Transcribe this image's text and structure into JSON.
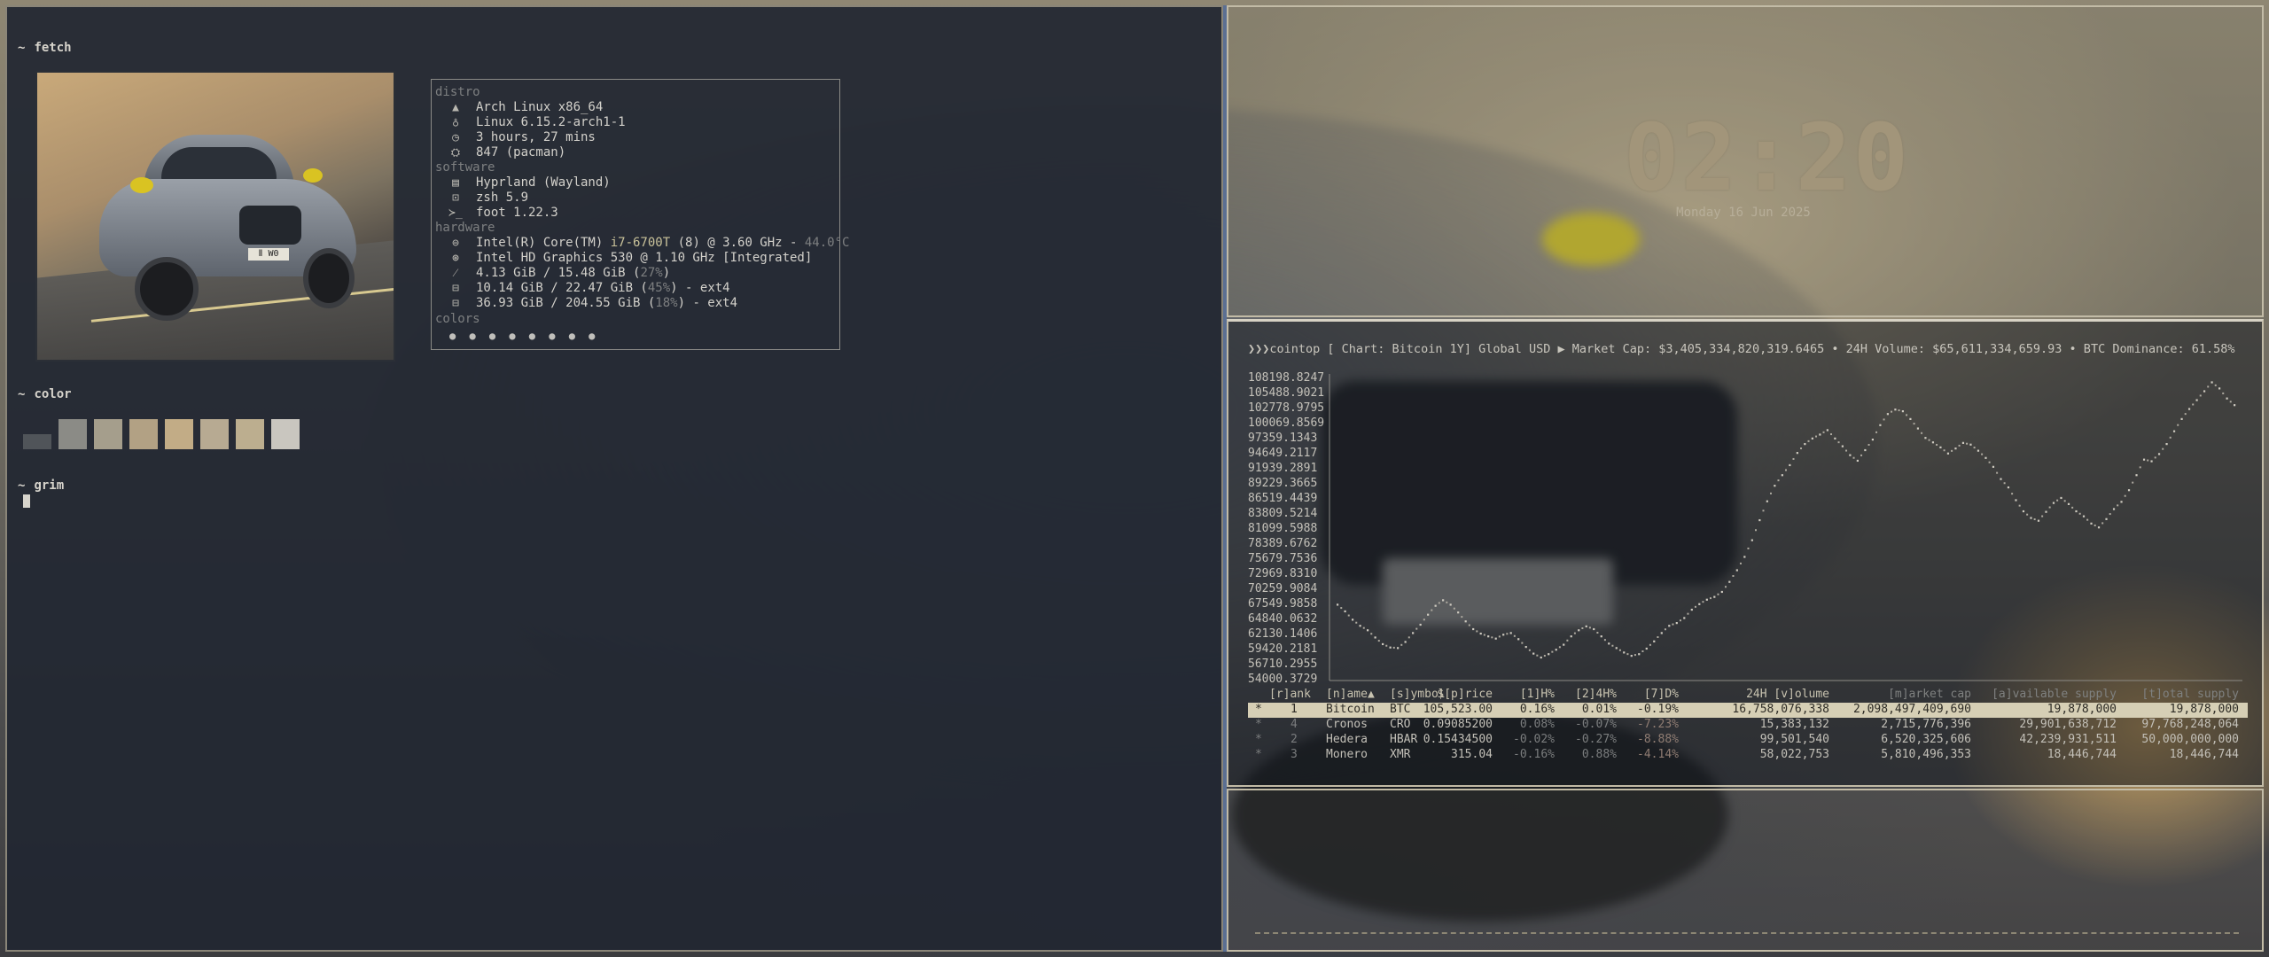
{
  "fetch": {
    "prompt_symbol": "~",
    "prompt_cmd": "fetch",
    "sections": {
      "distro": "distro",
      "software": "software",
      "hardware": "hardware",
      "colors": "colors"
    },
    "distro": [
      {
        "icon": "arch-logo-icon",
        "text": "Arch Linux x86_64"
      },
      {
        "icon": "linux-tux-icon",
        "text": "Linux 6.15.2-arch1-1"
      },
      {
        "icon": "clock-icon",
        "text": "3 hours, 27 mins"
      },
      {
        "icon": "package-icon",
        "text": "847 (pacman)"
      }
    ],
    "software": [
      {
        "icon": "window-icon",
        "text": "Hyprland (Wayland)"
      },
      {
        "icon": "terminal-icon",
        "text": "zsh 5.9"
      },
      {
        "icon": "prompt-icon",
        "text": "foot 1.22.3"
      }
    ],
    "hardware": {
      "cpu_a": "Intel(R) Core(TM) ",
      "cpu_b": "i7-6700T",
      "cpu_c": " (8) @ 3.60 GHz - ",
      "cpu_temp": "44.0°C",
      "gpu": "Intel HD Graphics 530 @ 1.10 GHz [Integrated]",
      "mem_a": "4.13 GiB / 15.48 GiB (",
      "mem_pct": "27%",
      "mem_b": ")",
      "disk1_a": "10.14 GiB / 22.47 GiB (",
      "disk1_pct": "45%",
      "disk1_b": ") - ext4",
      "disk2_a": "36.93 GiB / 204.55 GiB (",
      "disk2_pct": "18%",
      "disk2_b": ") - ext4"
    },
    "color_dots": "● ● ● ● ● ● ● ●"
  },
  "color_prompt": {
    "symbol": "~",
    "cmd": "color"
  },
  "swatch_colors": [
    "#505459",
    "#8b8b86",
    "#a59e8c",
    "#b2a184",
    "#c2ac86",
    "#b7aa92",
    "#bcae8f",
    "#c9c6bf"
  ],
  "grim_prompt": {
    "symbol": "~",
    "cmd": "grim"
  },
  "clock": {
    "time": "02:20",
    "date": "Monday 16 Jun 2025"
  },
  "cointop": {
    "header": "❯❯❯cointop [ Chart: Bitcoin 1Y] Global USD ▶ Market Cap: $3,405,334,820,319.6465 • 24H Volume: $65,611,334,659.93 • BTC Dominance: 61.58%",
    "columns": {
      "rank": "[r]ank",
      "name": "[n]ame▲",
      "symbol": "[s]ymbol",
      "price": "$[p]rice",
      "h1": "[1]H%",
      "h24": "[2]4H%",
      "d7": "[7]D%",
      "volume": "24H [v]olume",
      "mcap": "[m]arket cap",
      "avail": "[a]vailable supply",
      "total": "[t]otal supply"
    },
    "rows": [
      {
        "star": "*",
        "rank": "1",
        "name": "Bitcoin",
        "symbol": "BTC",
        "price": "105,523.00",
        "h1": "0.16%",
        "h24": "0.01%",
        "d7": "-0.19%",
        "volume": "16,758,076,338",
        "mcap": "2,098,497,409,690",
        "avail": "19,878,000",
        "total": "19,878,000"
      },
      {
        "star": "*",
        "rank": "4",
        "name": "Cronos",
        "symbol": "CRO",
        "price": "0.09085200",
        "h1": "0.08%",
        "h24": "-0.07%",
        "d7": "-7.23%",
        "volume": "15,383,132",
        "mcap": "2,715,776,396",
        "avail": "29,901,638,712",
        "total": "97,768,248,064"
      },
      {
        "star": "*",
        "rank": "2",
        "name": "Hedera",
        "symbol": "HBAR",
        "price": "0.15434500",
        "h1": "-0.02%",
        "h24": "-0.27%",
        "d7": "-8.88%",
        "volume": "99,501,540",
        "mcap": "6,520,325,606",
        "avail": "42,239,931,511",
        "total": "50,000,000,000"
      },
      {
        "star": "*",
        "rank": "3",
        "name": "Monero",
        "symbol": "XMR",
        "price": "315.04",
        "h1": "-0.16%",
        "h24": "0.88%",
        "d7": "-4.14%",
        "volume": "58,022,753",
        "mcap": "5,810,496,353",
        "avail": "18,446,744",
        "total": "18,446,744"
      }
    ]
  },
  "chart_data": {
    "type": "scatter",
    "title": "Chart: Bitcoin 1Y",
    "ytick_labels": [
      "108198.8247",
      "105488.9021",
      "102778.9795",
      "100069.8569",
      "97359.1343",
      "94649.2117",
      "91939.2891",
      "89229.3665",
      "86519.4439",
      "83809.5214",
      "81099.5988",
      "78389.6762",
      "75679.7536",
      "72969.8310",
      "70259.9084",
      "67549.9858",
      "64840.0632",
      "62130.1406",
      "59420.2181",
      "56710.2955",
      "54000.3729"
    ],
    "ylim": [
      54000.3729,
      108198.8247
    ],
    "x": [
      0,
      1,
      2,
      3,
      4,
      5,
      6,
      7,
      8,
      9,
      10,
      11,
      12,
      13,
      14,
      15,
      16,
      17,
      18,
      19,
      20,
      21,
      22,
      23,
      24,
      25,
      26,
      27,
      28,
      29,
      30,
      31,
      32,
      33,
      34,
      35,
      36,
      37,
      38,
      39,
      40,
      41,
      42,
      43,
      44,
      45,
      46,
      47,
      48,
      49,
      50,
      51,
      52,
      53,
      54,
      55,
      56,
      57,
      58,
      59,
      60,
      61,
      62,
      63,
      64,
      65,
      66,
      67,
      68,
      69,
      70,
      71,
      72,
      73,
      74,
      75,
      76,
      77,
      78,
      79,
      80,
      81,
      82,
      83,
      84,
      85,
      86,
      87,
      88,
      89,
      90,
      91,
      92,
      93,
      94,
      95,
      96,
      97,
      98,
      99,
      100,
      101,
      102,
      103,
      104,
      105,
      106,
      107,
      108,
      109,
      110,
      111,
      112,
      113,
      114,
      115,
      116,
      117,
      118,
      119
    ],
    "y": [
      67500,
      66300,
      64800,
      63700,
      62900,
      61600,
      60400,
      59800,
      59700,
      60800,
      62400,
      63900,
      65700,
      67300,
      68300,
      67500,
      66100,
      64500,
      63100,
      62300,
      61800,
      61400,
      62100,
      62400,
      61300,
      59900,
      58700,
      58000,
      58600,
      59400,
      60300,
      61800,
      62900,
      63600,
      63100,
      61800,
      60500,
      59700,
      58900,
      58300,
      58600,
      59600,
      60900,
      62400,
      63700,
      64200,
      65100,
      66600,
      67600,
      68400,
      68900,
      69800,
      71600,
      73700,
      76100,
      79100,
      82700,
      86100,
      88900,
      90800,
      92600,
      94800,
      96400,
      97400,
      98100,
      98900,
      97400,
      96000,
      94400,
      93400,
      95300,
      97200,
      99800,
      101800,
      102600,
      102300,
      100900,
      99200,
      97500,
      96700,
      95800,
      94700,
      95600,
      96600,
      96300,
      95200,
      93900,
      92300,
      90100,
      88600,
      86300,
      84300,
      83100,
      82600,
      84200,
      85800,
      86700,
      85600,
      84300,
      83400,
      82100,
      81400,
      82900,
      84700,
      86000,
      88100,
      90800,
      93600,
      93300,
      94600,
      96400,
      98700,
      100900,
      102700,
      104300,
      105900,
      107500,
      106400,
      104600,
      103400
    ]
  }
}
